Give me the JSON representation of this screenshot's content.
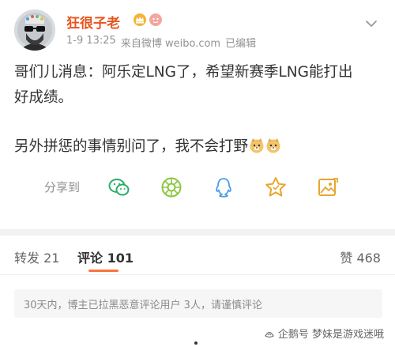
{
  "post": {
    "username": "狂很子老",
    "time": "1-9 13:25",
    "source": "来自微博 weibo.com",
    "edited": "已编辑",
    "content_line1": "哥们儿消息：阿乐定LNG了，希望新赛季LNG能打出",
    "content_line2": "好成绩。",
    "content_line3": "另外拼惩的事情别问了，我不会打野",
    "share_label": "分享到",
    "share_icons": [
      "wechat-icon",
      "moments-icon",
      "qq-icon",
      "favorite-star-icon",
      "image-icon"
    ]
  },
  "tabs": {
    "repost": "转发 21",
    "comments": "评论 101",
    "likes": "赞 468"
  },
  "notice": "30天内，博主已拉黑恶意评论用户 3人，请谨慎评论",
  "watermark": "企鹅号 梦妹是游戏迷哦",
  "colors": {
    "username": "#e8541e",
    "accent": "#f7743c",
    "icon_green": "#2aae67",
    "icon_blue": "#4a9be8",
    "icon_gold": "#e9a52c"
  }
}
